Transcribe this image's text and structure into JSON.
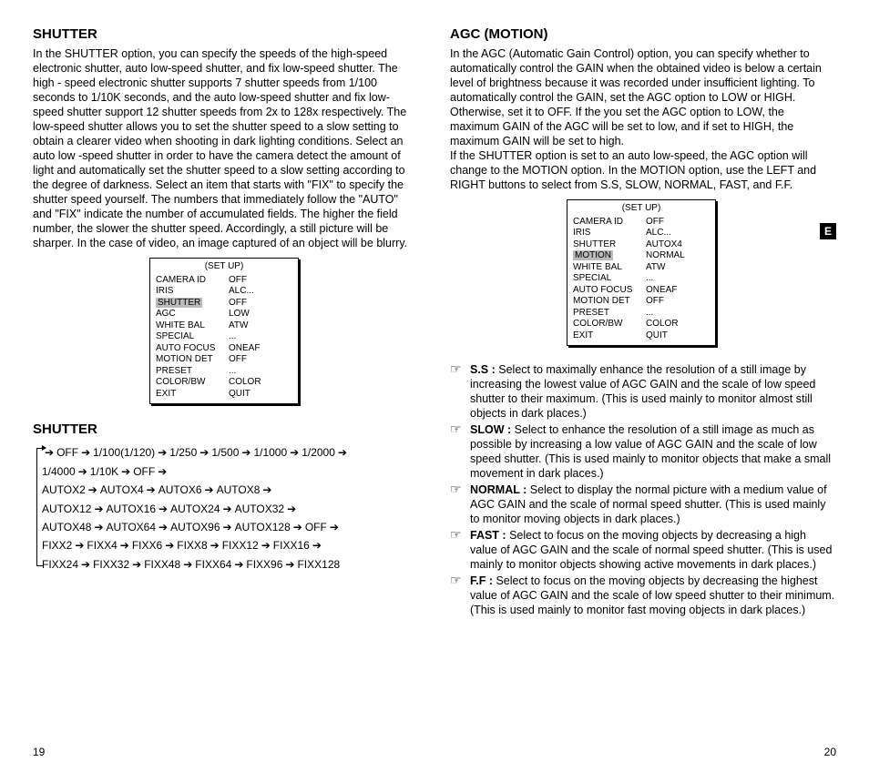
{
  "left": {
    "h1": "SHUTTER",
    "para": "In the SHUTTER option, you can specify the speeds of the high-speed electronic shutter, auto low-speed shutter, and fix low-speed shutter. The high - speed electronic shutter supports 7 shutter speeds from 1/100 seconds to 1/10K seconds, and the auto low-speed shutter and fix low-speed shutter support 12 shutter speeds from 2x to 128x respectively. The low-speed shutter allows you to set the shutter speed to a slow setting to obtain a clearer video when shooting in dark lighting conditions.  Select an auto low -speed shutter in order to have the camera detect the amount of light and automatically set the shutter speed to a slow setting according to the degree of darkness. Select an item that starts with \"FIX\" to specify the shutter speed yourself. The numbers that immediately follow the \"AUTO\" and \"FIX\" indicate the number of accumulated fields. The higher the field number, the slower the shutter speed. Accordingly, a still picture will be sharper. In the case of video, an image captured of an object will be blurry.",
    "menu": {
      "title": "(SET UP)",
      "highlight": "SHUTTER",
      "rows": [
        {
          "label": "CAMERA ID",
          "val": "OFF"
        },
        {
          "label": "IRIS",
          "val": "ALC..."
        },
        {
          "label": "SHUTTER",
          "val": "OFF"
        },
        {
          "label": "AGC",
          "val": "LOW"
        },
        {
          "label": "WHITE BAL",
          "val": "ATW"
        },
        {
          "label": "SPECIAL",
          "val": "..."
        },
        {
          "label": "AUTO FOCUS",
          "val": "ONEAF"
        },
        {
          "label": "MOTION DET",
          "val": "OFF"
        },
        {
          "label": "PRESET",
          "val": "..."
        },
        {
          "label": "COLOR/BW",
          "val": "COLOR"
        },
        {
          "label": "EXIT",
          "val": "QUIT"
        }
      ]
    },
    "h2": "SHUTTER",
    "shutter_values": [
      "OFF",
      "1/100(1/120)",
      "1/250",
      "1/500",
      "1/1000",
      "1/2000",
      "1/4000",
      "1/10K",
      "OFF",
      "AUTOX2",
      "AUTOX4",
      "AUTOX6",
      "AUTOX8",
      "AUTOX12",
      "AUTOX16",
      "AUTOX24",
      "AUTOX32",
      "AUTOX48",
      "AUTOX64",
      "AUTOX96",
      "AUTOX128",
      "OFF",
      "FIXX2",
      "FIXX4",
      "FIXX6",
      "FIXX8",
      "FIXX12",
      "FIXX16",
      "FIXX24",
      "FIXX32",
      "FIXX48",
      "FIXX64",
      "FIXX96",
      "FIXX128"
    ],
    "page_num": "19"
  },
  "right": {
    "h1": "AGC (MOTION)",
    "para": "In the AGC (Automatic Gain Control) option, you can specify whether to automatically control the GAIN when the obtained video is below a certain level of brightness because it was recorded under insufficient lighting. To automatically control the GAIN, set the AGC option to LOW or HIGH. Otherwise, set it to OFF.  If the you set the AGC option to LOW, the maximum GAIN of the AGC will be set to low, and if set to HIGH, the maximum GAIN will be set to high.\nIf the SHUTTER option is set to an auto low-speed, the AGC option will change to the MOTION option. In the MOTION option, use the LEFT and RIGHT buttons to select from S.S, SLOW, NORMAL, FAST, and F.F.",
    "menu": {
      "title": "(SET UP)",
      "highlight": "MOTION",
      "rows": [
        {
          "label": "CAMERA ID",
          "val": "OFF"
        },
        {
          "label": "IRIS",
          "val": "ALC..."
        },
        {
          "label": "SHUTTER",
          "val": "AUTOX4"
        },
        {
          "label": "MOTION",
          "val": "NORMAL"
        },
        {
          "label": "WHITE BAL",
          "val": "ATW"
        },
        {
          "label": "SPECIAL",
          "val": "..."
        },
        {
          "label": "AUTO FOCUS",
          "val": "ONEAF"
        },
        {
          "label": "MOTION DET",
          "val": "OFF"
        },
        {
          "label": "PRESET",
          "val": "..."
        },
        {
          "label": "COLOR/BW",
          "val": "COLOR"
        },
        {
          "label": "EXIT",
          "val": "QUIT"
        }
      ]
    },
    "defs": [
      {
        "term": "S.S :",
        "text": " Select to maximally enhance the resolution of a still image by increasing the lowest value of AGC GAIN and the scale of low speed shutter to their maximum. (This is used mainly to monitor almost still objects in dark places.)"
      },
      {
        "term": "SLOW :",
        "text": " Select to enhance the resolution of a still image as much as possible by increasing a low value of AGC GAIN and the scale of low speed shutter. (This is used mainly to monitor objects that make a small movement in dark places.)"
      },
      {
        "term": "NORMAL :",
        "text": " Select to display the normal picture with a medium value of AGC GAIN and the scale of normal speed shutter. (This is used mainly to monitor moving objects in dark places.)"
      },
      {
        "term": "FAST :",
        "text": " Select to focus on the moving objects by decreasing a high value of AGC GAIN and the scale of normal speed shutter. (This is used mainly to monitor objects showing active movements in dark places.)"
      },
      {
        "term": "F.F :",
        "text": " Select to focus on the moving objects by decreasing the highest value of AGC GAIN and the scale of low speed shutter to their minimum. (This is used mainly to monitor fast moving objects in dark places.)"
      }
    ],
    "page_num": "20",
    "lang_badge": "E"
  }
}
